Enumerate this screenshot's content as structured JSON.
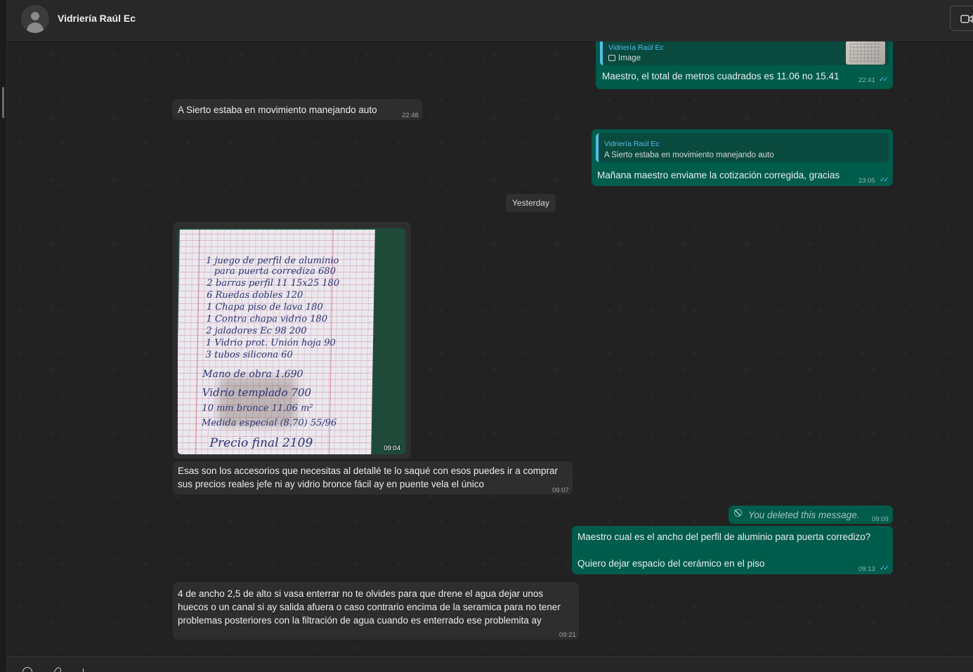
{
  "header": {
    "contact_name": "Vidriería Raúl Ec",
    "video_icon": "video-call-icon"
  },
  "messages": {
    "m1": {
      "quote_name": "Vidriería Raúl Ec",
      "quote_text": "Image",
      "quote_icon": "image-icon",
      "text": "Maestro, el total de metros cuadrados es 11.06 no 15.41",
      "time": "22:41"
    },
    "m2": {
      "text": "A Sierto estaba en movimiento manejando auto",
      "time": "22:48"
    },
    "m3": {
      "quote_name": "Vidriería Raúl Ec",
      "quote_text": "A Sierto estaba en movimiento manejando auto",
      "text": "Mañana maestro enviame la cotización corregida, gracias",
      "time": "23:05"
    },
    "date_divider": "Yesterday",
    "m4": {
      "time": "09:04",
      "photo_lines": [
        "1 juego de perfil de aluminio",
        "para puerta corrediza   680",
        "2 barras perfil 11 15x25   180",
        "6 Ruedas dobles   120",
        "1 Chapa piso de lava   180",
        "1 Contra chapa vidrio   180",
        "2 jaladores Ec 98   200",
        "1 Vidrio prot. Unión hoja   90",
        "3 tubos silicona   60",
        "Mano de obra   1.690",
        "Vidrio templado   700",
        "10 mm bronce 11.06 m²",
        "Medida especial (8.70)   55/96",
        "Precio final   2109"
      ]
    },
    "m5": {
      "line1": "Esas son los accesorios que necesitas al detallé te lo saqué con esos puedes ir a comprar",
      "line2": "sus precios reales jefe ni ay vidrio bronce fácil ay en puente vela el único",
      "time": "09:07"
    },
    "m6": {
      "text": "You deleted this message.",
      "time": "09:09"
    },
    "m7": {
      "line1": "Maestro cual es el ancho del perfil de aluminio para puerta corredizo?",
      "line2": "Quiero dejar espacio del cerámico en el piso",
      "time": "09:13"
    },
    "m8": {
      "line1": "4 de ancho 2,5 de alto si vasa enterrar no te olvides para que drene el agua dejar unos",
      "line2": "huecos o un canal si ay salida afuera o caso contrario encima de la seramica para no tener",
      "line3": "problemas posteriores con la filtración de agua cuando es enterrado ese problemita ay",
      "time": "09:21"
    }
  },
  "colors": {
    "incoming_bubble": "#2e2e2e",
    "outgoing_bubble": "#005c4b",
    "read_ticks": "#53bdeb"
  }
}
